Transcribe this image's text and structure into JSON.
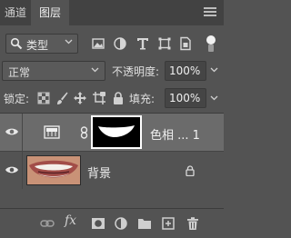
{
  "tabs": [
    {
      "label": "通道",
      "active": false
    },
    {
      "label": "图层",
      "active": true
    }
  ],
  "filter": {
    "kind_label": "类型",
    "icons": [
      "image-filter-icon",
      "adjustment-filter-icon",
      "type-filter-icon",
      "shape-filter-icon",
      "smart-object-filter-icon",
      "filter-toggle-icon"
    ]
  },
  "blend_mode": "正常",
  "opacity": {
    "label": "不透明度:",
    "value": "100%"
  },
  "lock": {
    "label": "锁定:",
    "icons": [
      "lock-transparent-pixels-icon",
      "lock-image-pixels-icon",
      "lock-position-icon",
      "lock-artboard-icon",
      "lock-all-icon"
    ]
  },
  "fill": {
    "label": "填充:",
    "value": "100%"
  },
  "layers": [
    {
      "name": "色相 ... 1",
      "type": "adjustment",
      "visible": true,
      "selected": true
    },
    {
      "name": "背景",
      "type": "background",
      "visible": true,
      "selected": false,
      "locked": true
    }
  ],
  "footer_icons": [
    "link-layers-icon",
    "fx-icon",
    "add-mask-icon",
    "new-adjustment-icon",
    "new-group-icon",
    "new-layer-icon",
    "delete-layer-icon"
  ],
  "fx_label": "fx",
  "colors": {
    "panel": "#535353",
    "tabbar": "#424242",
    "selected_layer": "#6b6b6b"
  }
}
